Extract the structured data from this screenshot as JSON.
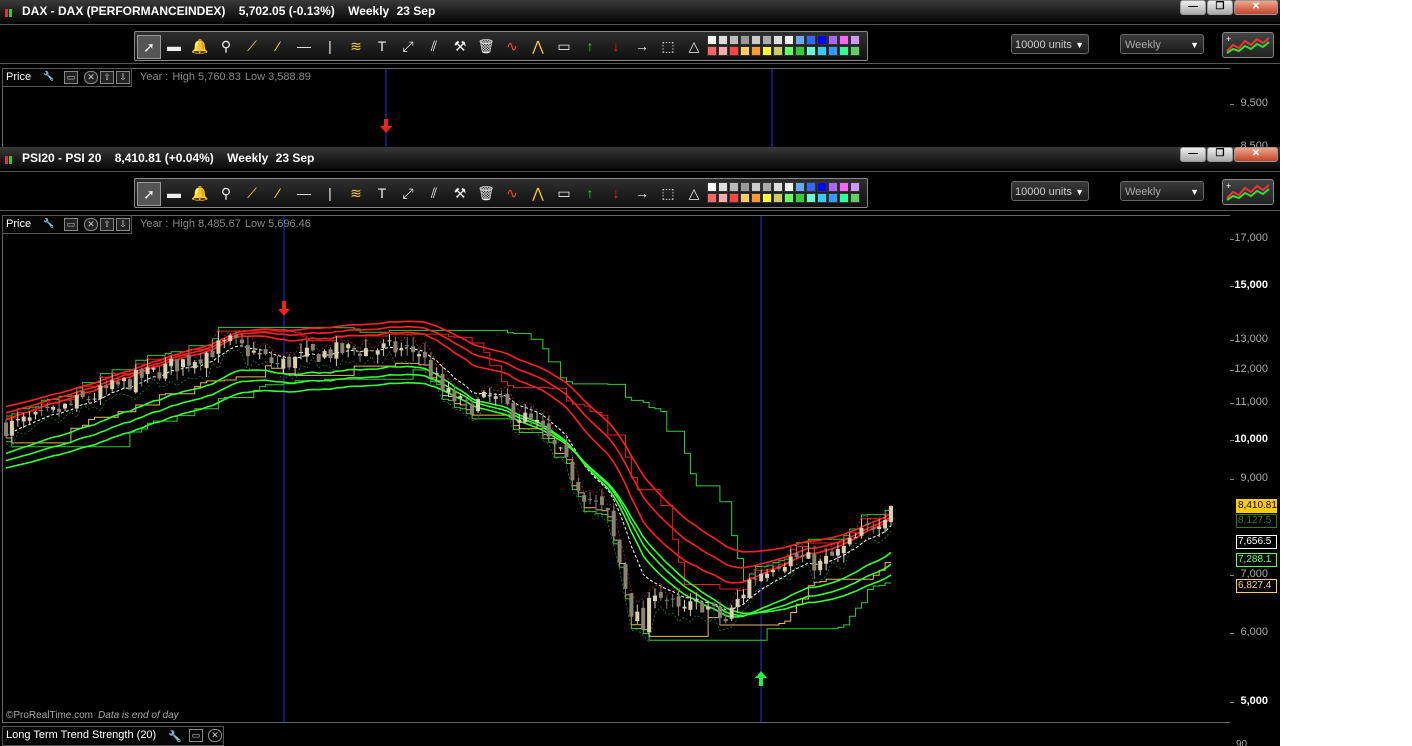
{
  "panel1": {
    "title_name": "DAX - DAX (PERFORMANCEINDEX)",
    "title_price": "5,702.05 (-0.13%)",
    "title_period": "Weekly",
    "title_date": "23 Sep",
    "units": "10000 units",
    "period_select": "Weekly",
    "price_label": "Price",
    "year_label": "Year :",
    "year_high": "High 5,760.83",
    "year_low": "Low 3,588.89",
    "axis_ticks": [
      "9,500",
      "8,500"
    ]
  },
  "panel2": {
    "title_name": "PSI20 - PSI 20",
    "title_price": "8,410.81 (+0.04%)",
    "title_period": "Weekly",
    "title_date": "23 Sep",
    "units": "10000 units",
    "period_select": "Weekly",
    "price_label": "Price",
    "year_label": "Year :",
    "year_high": "High 8,485.67",
    "year_low": "Low 5,696.46",
    "footer_brand": "©ProRealTime.com",
    "footer_note": "Data is end of day",
    "indicator_label": "Long Term Trend Strength (20)",
    "indicator_axis_value": "90",
    "price_tags": [
      {
        "text": "8,410.81",
        "color": "#ffcc00",
        "text_color": "#000000"
      },
      {
        "text": "8,127.5",
        "color": "#000000",
        "text_color": "#3a7a1a"
      },
      {
        "text": "7,656.5",
        "color": "#000000",
        "text_color": "#ffffff"
      },
      {
        "text": "7,288.1",
        "color": "#000000",
        "text_color": "#66ff66"
      },
      {
        "text": "6,827.4",
        "color": "#000000",
        "text_color": "#ffcc66"
      }
    ]
  },
  "window_buttons": {
    "minimize": "—",
    "restore": "❐",
    "close": "✕"
  },
  "icons": {
    "pointer": "pointer-icon",
    "ruler": "ruler-icon",
    "alarm": "alarm-bell-icon",
    "zoom": "zoom-icon",
    "segment": "segment-icon",
    "line": "trend-line-icon",
    "hline": "horizontal-line-icon",
    "vline": "vertical-line-icon",
    "fib": "fibonacci-icon",
    "text": "text-icon",
    "expand": "expand-icon",
    "channel": "channel-icon",
    "tools": "tools-icon",
    "trash": "trash-icon",
    "ma": "ma-icon",
    "zigzag": "zigzag-icon",
    "rect": "rectangle-icon",
    "up_arrow": "up-arrow-icon",
    "down_arrow": "down-arrow-icon",
    "right_arrow": "right-arrow-icon",
    "lasso": "lasso-icon",
    "triangle": "triangle-icon"
  },
  "colors": {
    "background": "#000000",
    "bull_candle": "#d8ceb0",
    "bear_candle": "#8a8370",
    "upper_band_red": "#ff2020",
    "lower_band_green": "#33ff33",
    "cursor_line": "#2233cc"
  },
  "chart_data": {
    "type": "candlestick",
    "title": "PSI20 - PSI 20",
    "x_period": "weekly",
    "ylim": [
      5000,
      17500
    ],
    "y_scale": "log",
    "y_ticks": [
      5000,
      6000,
      7000,
      9000,
      10000,
      11000,
      12000,
      13000,
      15000,
      17000
    ],
    "y_tick_labels": [
      "5,000",
      "6,000",
      "7,000",
      "9,000",
      "10,000",
      "11,000",
      "12,000",
      "13,000",
      "15,000",
      "17,000"
    ],
    "major_ticks": [
      5000,
      10000,
      15000
    ],
    "last_close": 8410.81,
    "signals": [
      {
        "type": "sell",
        "index": 42
      },
      {
        "type": "buy",
        "index": 123
      }
    ],
    "close_path": [
      [
        0,
        10380
      ],
      [
        6,
        10600
      ],
      [
        14,
        11200
      ],
      [
        24,
        11900
      ],
      [
        32,
        12450
      ],
      [
        38,
        12950
      ],
      [
        42,
        12600
      ],
      [
        46,
        12200
      ],
      [
        52,
        12550
      ],
      [
        58,
        12700
      ],
      [
        64,
        12750
      ],
      [
        70,
        12650
      ],
      [
        74,
        11400
      ],
      [
        78,
        10900
      ],
      [
        82,
        11200
      ],
      [
        86,
        10800
      ],
      [
        90,
        10400
      ],
      [
        94,
        9600
      ],
      [
        98,
        8700
      ],
      [
        102,
        8200
      ],
      [
        106,
        6400
      ],
      [
        108,
        6100
      ],
      [
        110,
        6800
      ],
      [
        114,
        6350
      ],
      [
        118,
        6500
      ],
      [
        122,
        6200
      ],
      [
        126,
        6900
      ],
      [
        130,
        7250
      ],
      [
        134,
        7350
      ],
      [
        138,
        7200
      ],
      [
        142,
        7500
      ],
      [
        146,
        7900
      ],
      [
        150,
        8410.81
      ]
    ],
    "bars": 151
  }
}
